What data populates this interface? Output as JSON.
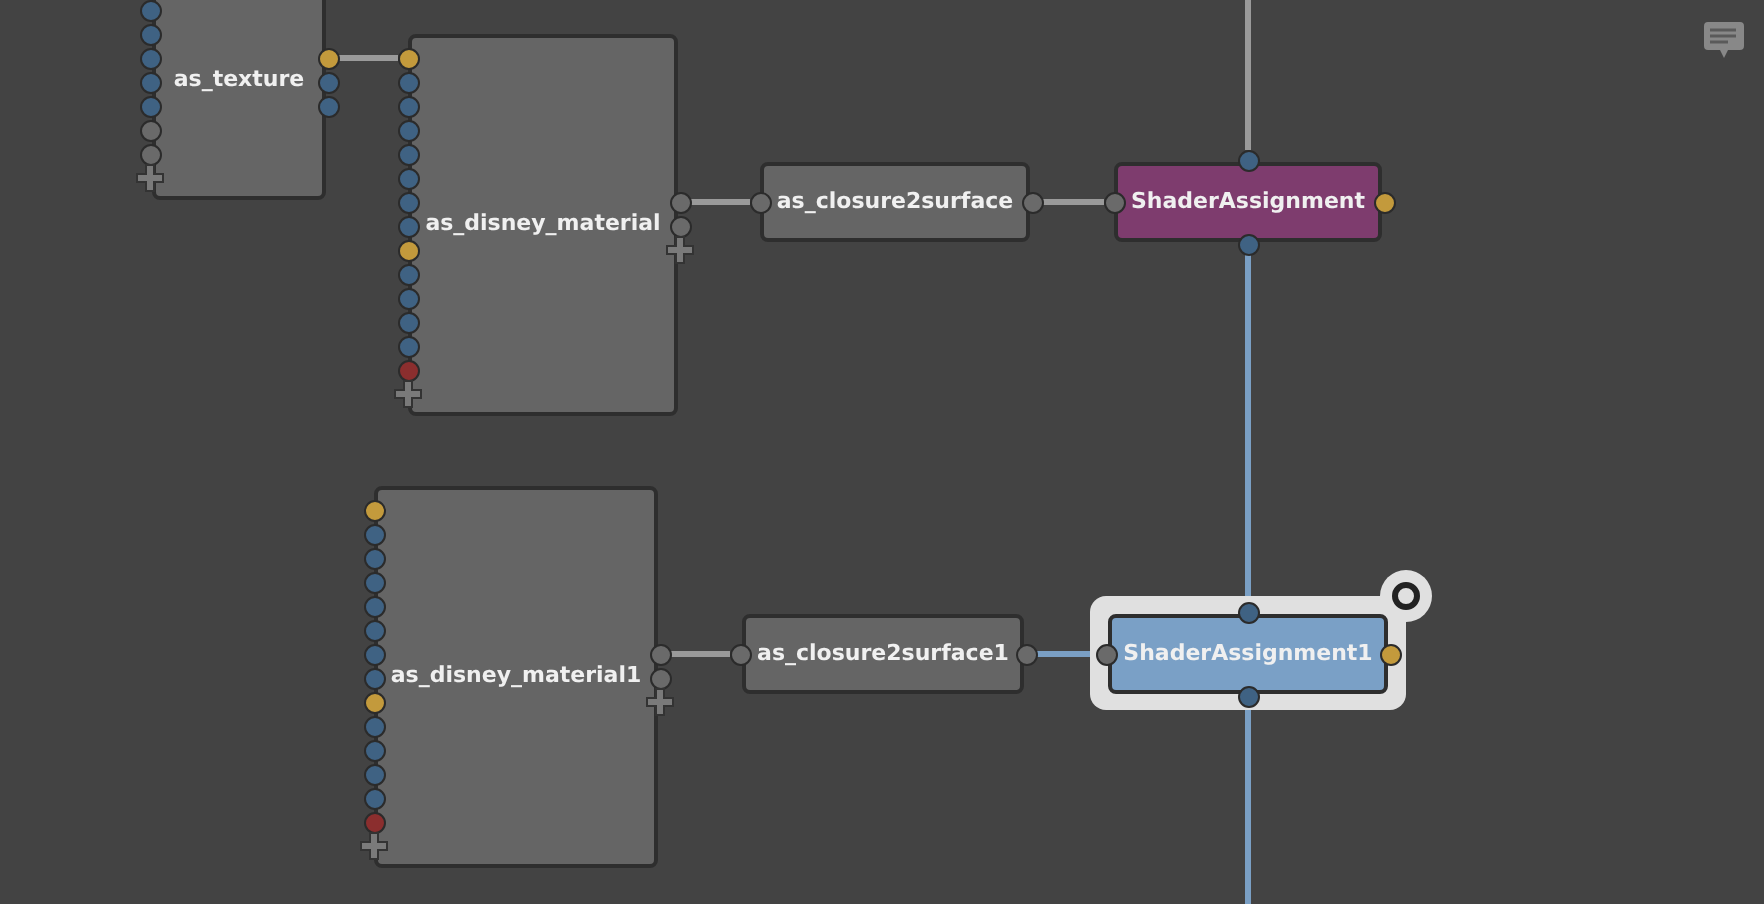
{
  "nodes": [
    {
      "label": "as_texture",
      "kind": "shader",
      "selected": false,
      "inputs": [
        {
          "color": "#3f6283"
        },
        {
          "color": "#3f6283"
        },
        {
          "color": "#3f6283"
        },
        {
          "color": "#3f6283"
        },
        {
          "color": "#3f6283"
        },
        {
          "color": "#6a6a6a"
        },
        {
          "color": "#6a6a6a"
        }
      ],
      "outputs": [
        {
          "color": "#c39a3c"
        },
        {
          "color": "#3f6283"
        },
        {
          "color": "#3f6283"
        }
      ]
    },
    {
      "label": "as_disney_material",
      "kind": "shader",
      "selected": false,
      "inputs": [
        {
          "color": "#c39a3c"
        },
        {
          "color": "#3f6283"
        },
        {
          "color": "#3f6283"
        },
        {
          "color": "#3f6283"
        },
        {
          "color": "#3f6283"
        },
        {
          "color": "#3f6283"
        },
        {
          "color": "#3f6283"
        },
        {
          "color": "#3f6283"
        },
        {
          "color": "#c39a3c"
        },
        {
          "color": "#3f6283"
        },
        {
          "color": "#3f6283"
        },
        {
          "color": "#3f6283"
        },
        {
          "color": "#3f6283"
        },
        {
          "color": "#8b2e2e"
        }
      ],
      "outputs": [
        {
          "color": "#6a6a6a"
        },
        {
          "color": "#6a6a6a"
        }
      ]
    },
    {
      "label": "as_closure2surface",
      "kind": "closure",
      "selected": false,
      "inputs": [
        {
          "color": "#6a6a6a"
        }
      ],
      "outputs": [
        {
          "color": "#6a6a6a"
        }
      ]
    },
    {
      "label": "ShaderAssignment",
      "kind": "assignment",
      "selected": false,
      "inputs": [
        {
          "color": "#6a6a6a"
        }
      ],
      "outputs": [
        {
          "color": "#c39a3c"
        }
      ],
      "top": [
        {
          "color": "#3f6283"
        }
      ],
      "bottom": [
        {
          "color": "#3f6283"
        }
      ]
    },
    {
      "label": "as_disney_material1",
      "kind": "shader",
      "selected": false,
      "inputs": [
        {
          "color": "#c39a3c"
        },
        {
          "color": "#3f6283"
        },
        {
          "color": "#3f6283"
        },
        {
          "color": "#3f6283"
        },
        {
          "color": "#3f6283"
        },
        {
          "color": "#3f6283"
        },
        {
          "color": "#3f6283"
        },
        {
          "color": "#3f6283"
        },
        {
          "color": "#c39a3c"
        },
        {
          "color": "#3f6283"
        },
        {
          "color": "#3f6283"
        },
        {
          "color": "#3f6283"
        },
        {
          "color": "#3f6283"
        },
        {
          "color": "#8b2e2e"
        }
      ],
      "outputs": [
        {
          "color": "#6a6a6a"
        },
        {
          "color": "#6a6a6a"
        }
      ]
    },
    {
      "label": "as_closure2surface1",
      "kind": "closure",
      "selected": false,
      "inputs": [
        {
          "color": "#6a6a6a"
        }
      ],
      "outputs": [
        {
          "color": "#6a6a6a"
        }
      ]
    },
    {
      "label": "ShaderAssignment1",
      "kind": "assignment",
      "selected": true,
      "inputs": [
        {
          "color": "#6a6a6a"
        }
      ],
      "outputs": [
        {
          "color": "#c39a3c"
        }
      ],
      "top": [
        {
          "color": "#3f6283"
        }
      ],
      "bottom": [
        {
          "color": "#3f6283"
        }
      ]
    }
  ]
}
